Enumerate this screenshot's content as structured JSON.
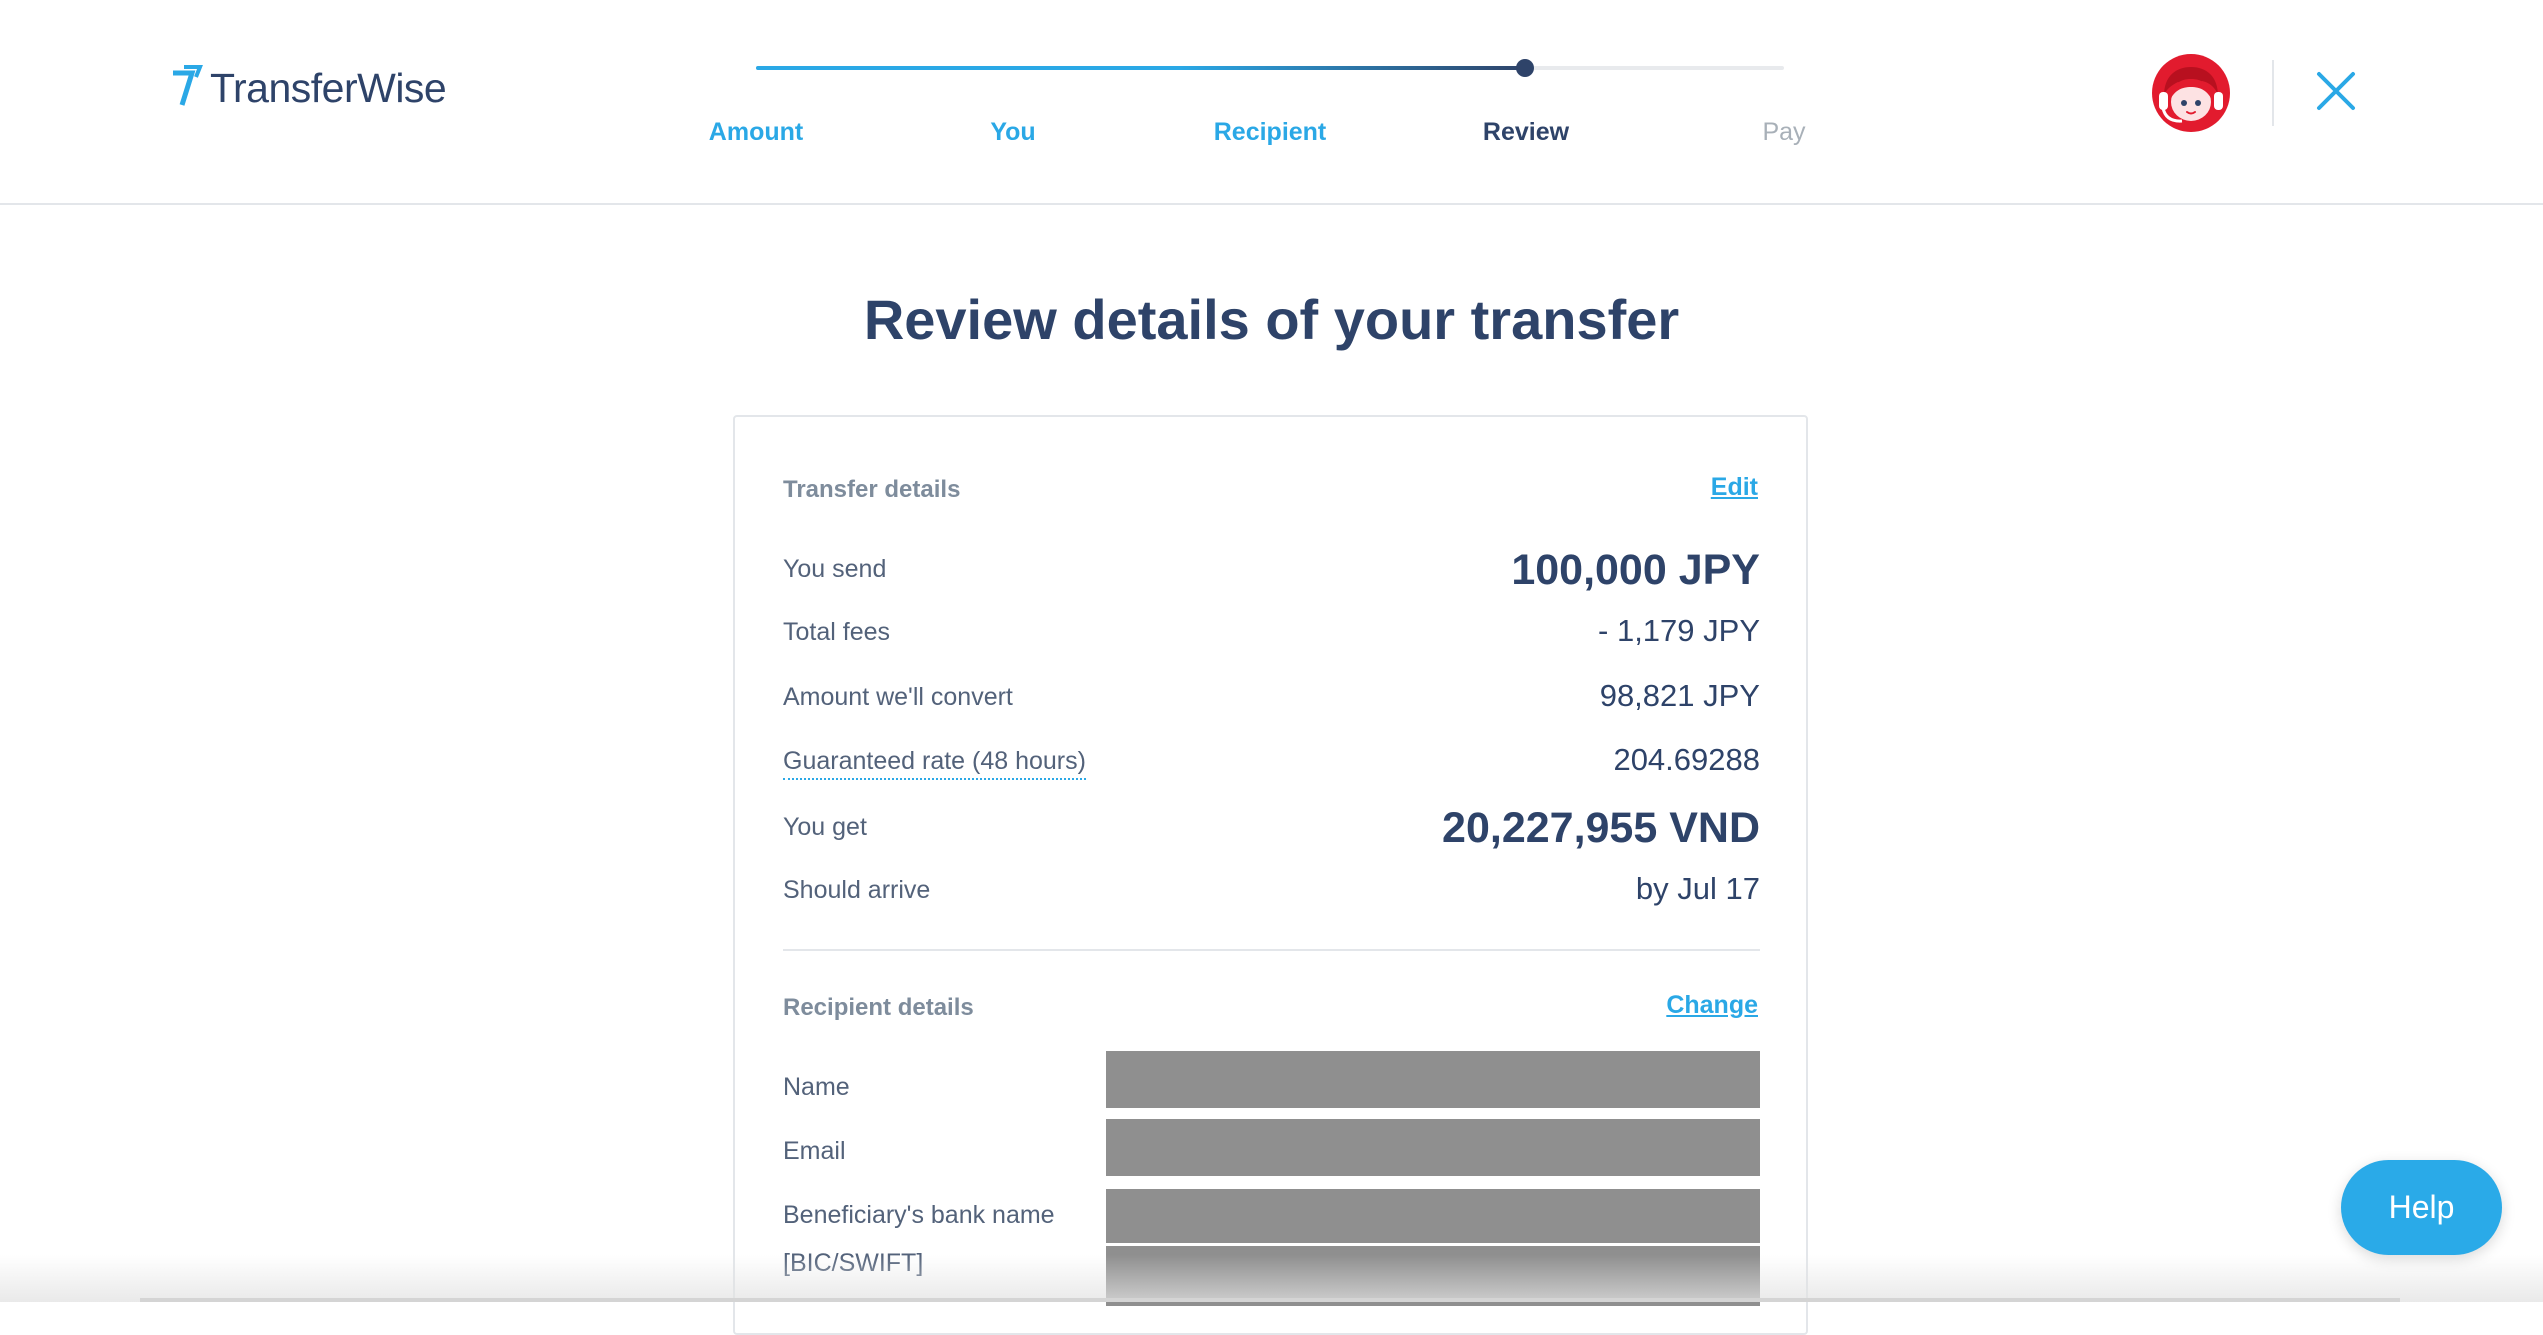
{
  "header": {
    "brand": "TransferWise",
    "steps": [
      {
        "label": "Amount",
        "state": "done"
      },
      {
        "label": "You",
        "state": "done"
      },
      {
        "label": "Recipient",
        "state": "done"
      },
      {
        "label": "Review",
        "state": "current"
      },
      {
        "label": "Pay",
        "state": "todo"
      }
    ],
    "avatar_icon": "support-agent-avatar-icon",
    "close_icon": "close-icon"
  },
  "main": {
    "title": "Review details of your transfer"
  },
  "transfer_details": {
    "title": "Transfer details",
    "edit_label": "Edit",
    "rows": [
      {
        "label": "You send",
        "value": "100,000 JPY"
      },
      {
        "label": "Total fees",
        "value": "- 1,179 JPY"
      },
      {
        "label": "Amount we'll convert",
        "value": "98,821 JPY"
      },
      {
        "label": "Guaranteed rate (48 hours)",
        "value": "204.69288"
      },
      {
        "label": "You get",
        "value": "20,227,955 VND"
      },
      {
        "label": "Should arrive",
        "value": "by Jul 17"
      }
    ]
  },
  "recipient_details": {
    "title": "Recipient details",
    "change_label": "Change",
    "fields": [
      {
        "label": "Name"
      },
      {
        "label": "Email"
      },
      {
        "label": "Beneficiary's bank name"
      },
      {
        "label": "[BIC/SWIFT]"
      }
    ]
  },
  "help": {
    "label": "Help"
  },
  "colors": {
    "accent": "#2aa8e6",
    "navy": "#2e4369",
    "muted": "#7e8c9c",
    "redacted": "#8f8f8f",
    "avatar_red": "#e21b2e"
  }
}
